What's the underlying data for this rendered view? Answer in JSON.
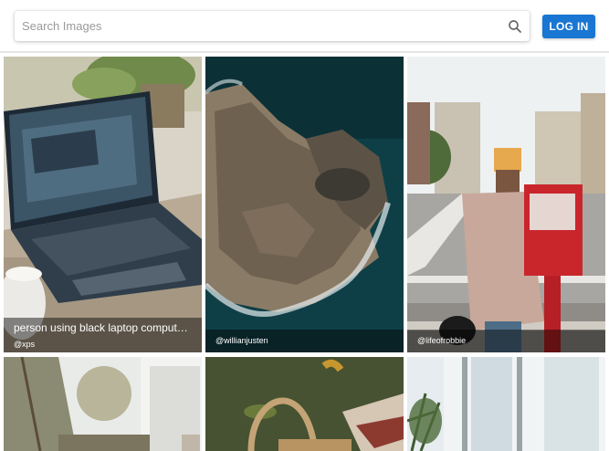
{
  "search": {
    "placeholder": "Search Images"
  },
  "header": {
    "login_label": "LOG IN"
  },
  "images": [
    {
      "title": "person using black laptop computer ...",
      "author": "@xps"
    },
    {
      "title": "",
      "author": "@willianjusten"
    },
    {
      "title": "",
      "author": "@lifeofrobbie"
    }
  ],
  "icons": {
    "search": "search-icon"
  },
  "colors": {
    "accent": "#1976d2"
  }
}
